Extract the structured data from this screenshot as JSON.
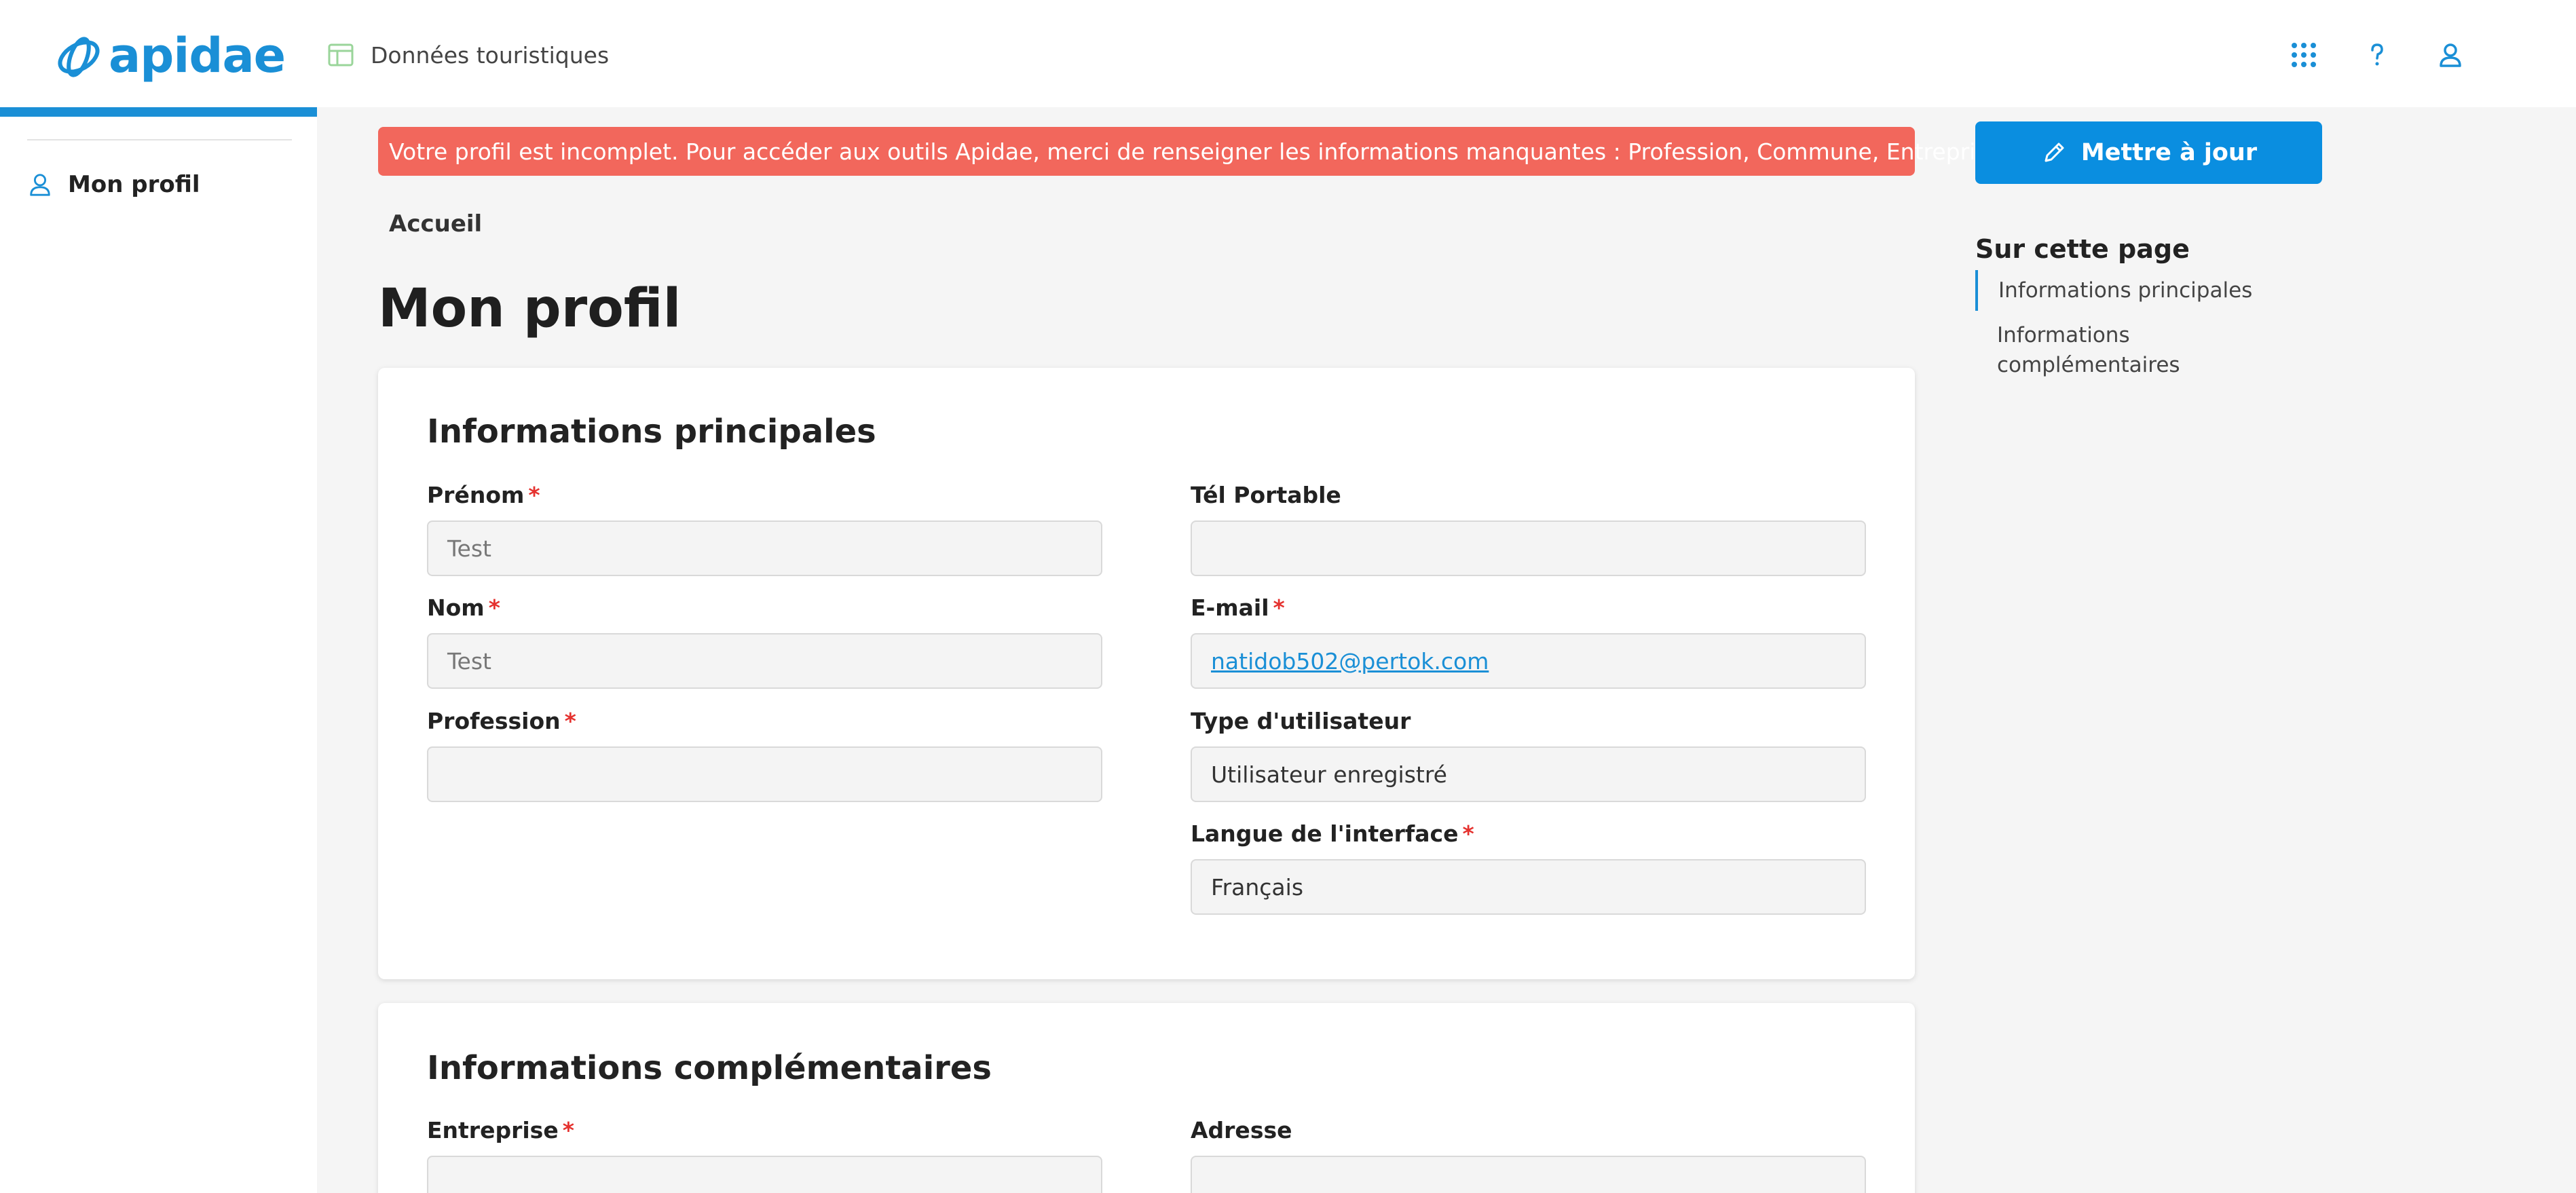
{
  "header": {
    "logo_text": "apidae",
    "section_label": "Données touristiques",
    "icons": [
      "apps-grid-icon",
      "help-icon",
      "user-icon"
    ]
  },
  "sidebar": {
    "items": [
      {
        "label": "Mon profil",
        "icon": "user-icon"
      }
    ]
  },
  "alert": {
    "text": "Votre profil est incomplet. Pour accéder aux outils Apidae, merci de renseigner les informations manquantes : Profession, Commune, Entreprise."
  },
  "breadcrumb": {
    "home": "Accueil"
  },
  "page": {
    "title": "Mon profil"
  },
  "sections": {
    "main": {
      "title": "Informations principales",
      "fields": {
        "prenom": {
          "label": "Prénom",
          "required": "*",
          "value": "Test"
        },
        "nom": {
          "label": "Nom",
          "required": "*",
          "value": "Test"
        },
        "profession": {
          "label": "Profession",
          "required": "*",
          "value": ""
        },
        "tel": {
          "label": "Tél Portable",
          "value": ""
        },
        "email": {
          "label": "E-mail",
          "required": "*",
          "value": "natidob502@pertok.com"
        },
        "type": {
          "label": "Type d'utilisateur",
          "value": "Utilisateur enregistré"
        },
        "langue": {
          "label": "Langue de l'interface",
          "required": "*",
          "value": "Français"
        }
      }
    },
    "extra": {
      "title": "Informations complémentaires",
      "fields": {
        "entreprise": {
          "label": "Entreprise",
          "required": "*",
          "value": ""
        },
        "adresse": {
          "label": "Adresse",
          "value": ""
        }
      }
    }
  },
  "actions": {
    "update_label": "Mettre à jour"
  },
  "toc": {
    "title": "Sur cette page",
    "items": [
      "Informations principales",
      "Informations complémentaires"
    ]
  },
  "colors": {
    "brand": "#1a8fd6",
    "alert_bg": "#f2675c",
    "button_bg": "#0a8ee0",
    "required": "#e5322f"
  }
}
